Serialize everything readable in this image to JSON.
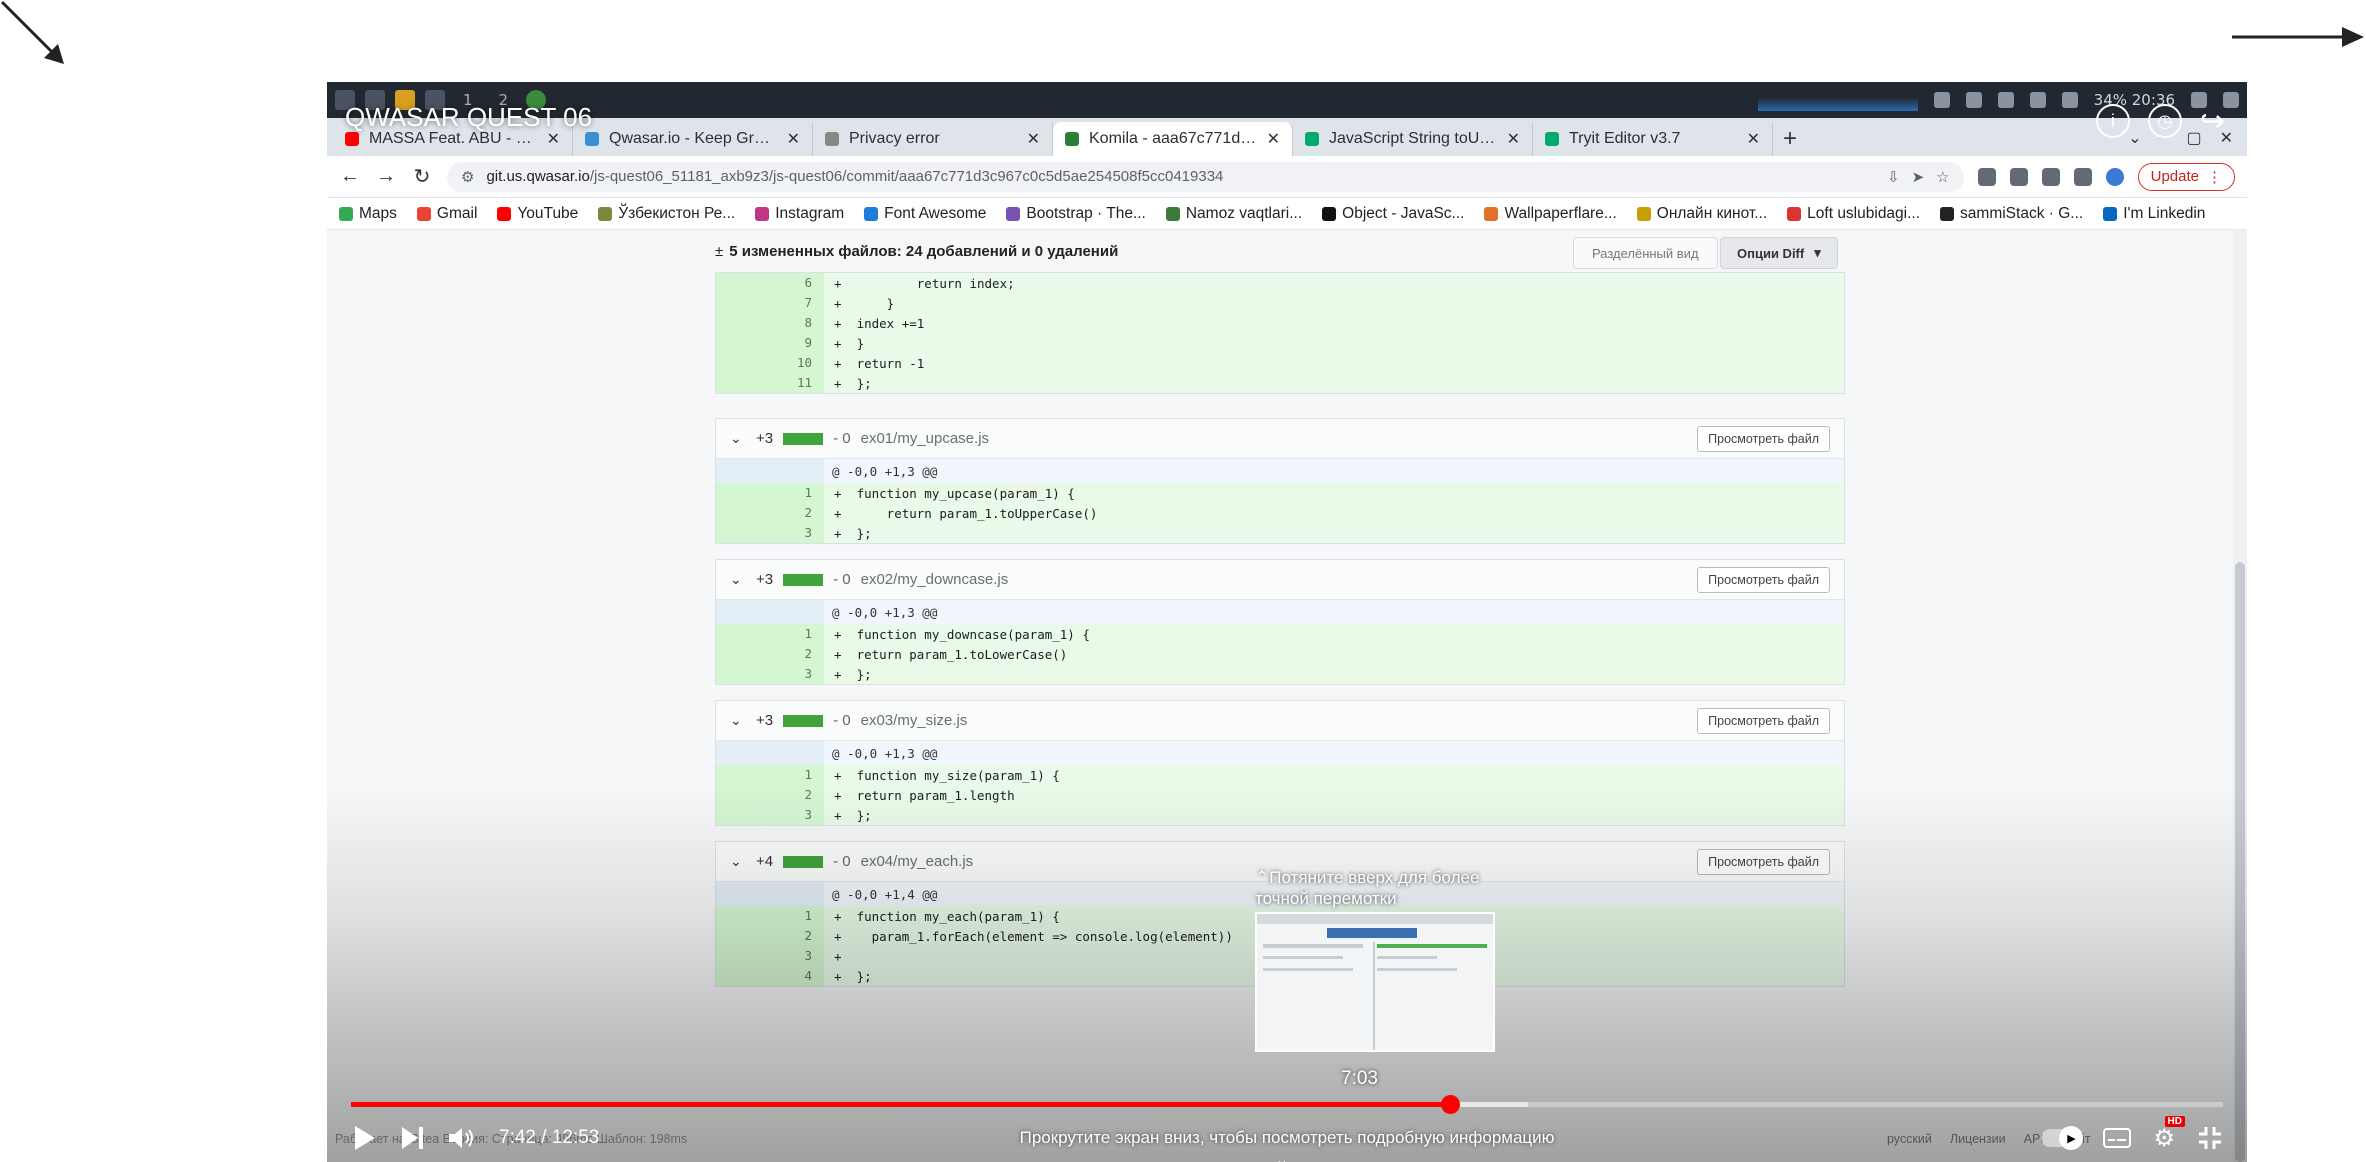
{
  "player": {
    "title": "QWASAR QUEST 06",
    "time_current": "7:42",
    "time_separator": " / ",
    "time_total": "12:53",
    "progress": 0.587,
    "buffered": 0.629,
    "preview_time": "7:03",
    "preview_hint": "Потяните вверх для более точной перемотки",
    "scroll_hint": "Прокрутите экран вниз, чтобы посмотреть подробную информацию",
    "icons": [
      "info-icon",
      "clock-icon",
      "share-icon",
      "play-icon",
      "next-icon",
      "volume-icon",
      "autoplay-toggle",
      "subtitles-icon",
      "settings-icon",
      "fullscreen-exit-icon"
    ],
    "hd_badge": "HD"
  },
  "desktop": {
    "workspaces": [
      "1",
      "2"
    ],
    "clock": "34% 20:36"
  },
  "browser": {
    "tabs": [
      {
        "label": "MASSA Feat. ABU - Benj",
        "favicon_color": "#ff0000",
        "close": "✕"
      },
      {
        "label": "Qwasar.io - Keep Growin",
        "favicon_color": "#3a8fd8",
        "close": "✕"
      },
      {
        "label": "Privacy error",
        "favicon_color": "#888888",
        "close": "✕"
      },
      {
        "label": "Komila - aaa67c771d - js-q",
        "favicon_color": "#2e7d32",
        "close": "✕",
        "active": true
      },
      {
        "label": "JavaScript String toUppe",
        "favicon_color": "#04aa6d",
        "close": "✕"
      },
      {
        "label": "Tryit Editor v3.7",
        "favicon_color": "#04aa6d",
        "close": "✕"
      }
    ],
    "new_tab": "+",
    "url_domain": "git.us.qwasar.io",
    "url_path": "/js-quest06_51181_axb9z3/js-quest06/commit/aaa67c771d3c967c0c5d5ae254508f5cc0419334",
    "update_label": "Update",
    "bookmarks": [
      {
        "label": "Maps",
        "color": "#34a853"
      },
      {
        "label": "Gmail",
        "color": "#ea4335"
      },
      {
        "label": "YouTube",
        "color": "#ff0000"
      },
      {
        "label": "Ўзбекистон Ре...",
        "color": "#7a8a3a"
      },
      {
        "label": "Instagram",
        "color": "#c13584"
      },
      {
        "label": "Font Awesome",
        "color": "#1c7ed6"
      },
      {
        "label": "Bootstrap · The...",
        "color": "#7952b3"
      },
      {
        "label": "Namoz vaqtlari...",
        "color": "#3a7a3a"
      },
      {
        "label": "Object - JavaSc...",
        "color": "#111111"
      },
      {
        "label": "Wallpaperflare...",
        "color": "#e0702a"
      },
      {
        "label": "Онлайн кинот...",
        "color": "#c8a000"
      },
      {
        "label": "Loft uslubidagi...",
        "color": "#d33"
      },
      {
        "label": "sammiStack · G...",
        "color": "#222222"
      },
      {
        "label": "I'm Linkedin",
        "color": "#0a66c2"
      }
    ]
  },
  "diff": {
    "summary_prefix": "±",
    "summary": "5 измененных файлов: 24 добавлений и 0 удалений",
    "split_view_label": "Разделённый вид",
    "diff_options_label": "Опции Diff",
    "view_file_label": "Просмотреть файл",
    "first_block_lines": [
      {
        "n": "6",
        "code": "+          return index;"
      },
      {
        "n": "7",
        "code": "+      }"
      },
      {
        "n": "8",
        "code": "+  index +=1"
      },
      {
        "n": "9",
        "code": "+  }"
      },
      {
        "n": "10",
        "code": "+  return -1"
      },
      {
        "n": "11",
        "code": "+  };"
      }
    ],
    "files": [
      {
        "add": "+3",
        "del": "- 0",
        "name": "ex01/my_upcase.js",
        "hunk": "@ -0,0 +1,3 @@",
        "lines": [
          {
            "n": "1",
            "code": "+  function my_upcase(param_1) {"
          },
          {
            "n": "2",
            "code": "+      return param_1.toUpperCase()"
          },
          {
            "n": "3",
            "code": "+  };"
          }
        ]
      },
      {
        "add": "+3",
        "del": "- 0",
        "name": "ex02/my_downcase.js",
        "hunk": "@ -0,0 +1,3 @@",
        "lines": [
          {
            "n": "1",
            "code": "+  function my_downcase(param_1) {"
          },
          {
            "n": "2",
            "code": "+  return param_1.toLowerCase()"
          },
          {
            "n": "3",
            "code": "+  };"
          }
        ]
      },
      {
        "add": "+3",
        "del": "- 0",
        "name": "ex03/my_size.js",
        "hunk": "@ -0,0 +1,3 @@",
        "lines": [
          {
            "n": "1",
            "code": "+  function my_size(param_1) {"
          },
          {
            "n": "2",
            "code": "+  return param_1.length"
          },
          {
            "n": "3",
            "code": "+  };"
          }
        ]
      },
      {
        "add": "+4",
        "del": "- 0",
        "name": "ex04/my_each.js",
        "hunk": "@ -0,0 +1,4 @@",
        "lines": [
          {
            "n": "1",
            "code": "+  function my_each(param_1) {"
          },
          {
            "n": "2",
            "code": "+    param_1.forEach(element => console.log(element))"
          },
          {
            "n": "3",
            "code": "+"
          },
          {
            "n": "4",
            "code": "+  };"
          }
        ]
      }
    ]
  },
  "page_status": {
    "left_text": "Работает на Gitea Версия: Страница: 496ms Шаблон: 198ms",
    "language": "русский",
    "license": "Лицензии",
    "api": "API",
    "site": "Сайт"
  }
}
